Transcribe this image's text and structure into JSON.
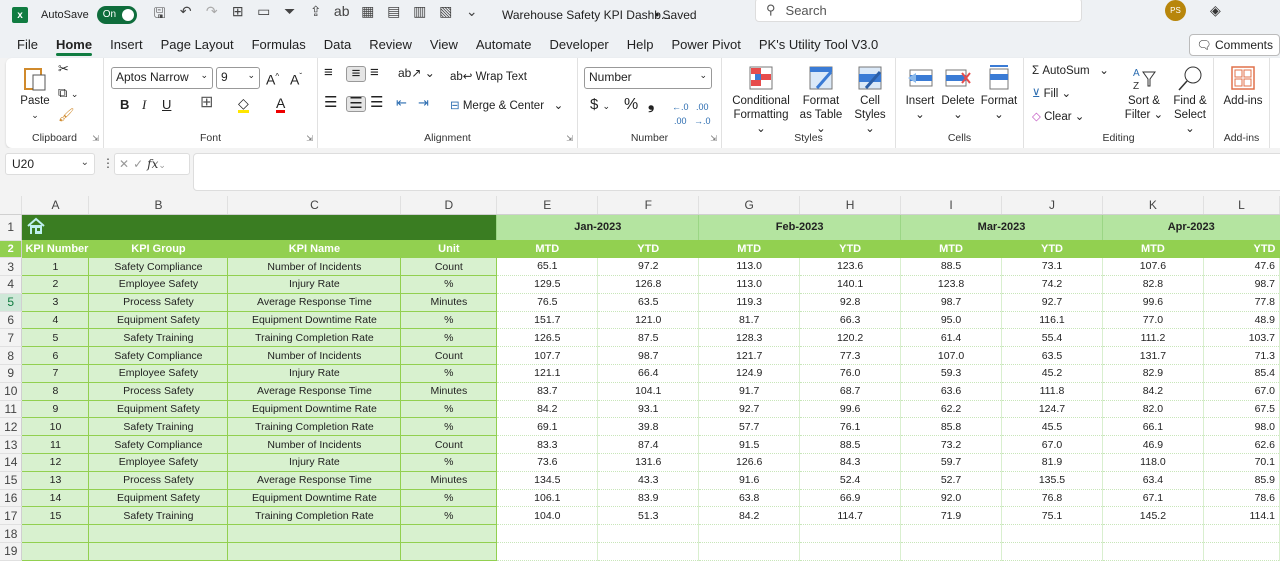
{
  "titlebar": {
    "autosave_label": "AutoSave",
    "autosave_state": "On",
    "doc_title": "Warehouse Safety KPI Dashb...",
    "saved_status": "• Saved",
    "search_placeholder": "Search",
    "user_initials": "PS"
  },
  "tabs": [
    "File",
    "Home",
    "Insert",
    "Page Layout",
    "Formulas",
    "Data",
    "Review",
    "View",
    "Automate",
    "Developer",
    "Help",
    "Power Pivot",
    "PK's Utility Tool V3.0"
  ],
  "active_tab": "Home",
  "comments_label": "Comments",
  "ribbon": {
    "clipboard": {
      "paste": "Paste",
      "label": "Clipboard"
    },
    "font": {
      "name": "Aptos Narrow",
      "size": "9",
      "label": "Font",
      "bold": "B",
      "italic": "I",
      "underline": "U"
    },
    "alignment": {
      "wrap_text": "Wrap Text",
      "merge_center": "Merge & Center",
      "label": "Alignment"
    },
    "number": {
      "format": "Number",
      "label": "Number",
      "currency": "$",
      "percent": "%",
      "comma": "❟",
      "inc_dec": ".00",
      "dec_dec": ".0"
    },
    "styles": {
      "conditional": "Conditional Formatting",
      "format_table": "Format as Table",
      "cell_styles": "Cell Styles",
      "label": "Styles"
    },
    "cells": {
      "insert": "Insert",
      "delete": "Delete",
      "format": "Format",
      "label": "Cells"
    },
    "editing": {
      "autosum": "AutoSum",
      "fill": "Fill",
      "clear": "Clear",
      "sort_filter": "Sort & Filter",
      "find_select": "Find & Select",
      "label": "Editing"
    },
    "addins": {
      "addins": "Add-ins",
      "label": "Add-ins"
    }
  },
  "formula_bar": {
    "name_box": "U20",
    "formula": ""
  },
  "sheet": {
    "columns": [
      "A",
      "B",
      "C",
      "D",
      "E",
      "F",
      "G",
      "H",
      "I",
      "J",
      "K",
      "L"
    ],
    "rows": [
      "1",
      "2",
      "3",
      "4",
      "5",
      "6",
      "7",
      "8",
      "9",
      "10",
      "11",
      "12",
      "13",
      "14",
      "15",
      "16",
      "17",
      "18",
      "19"
    ],
    "selected_row": "5",
    "months": [
      "Jan-2023",
      "Feb-2023",
      "Mar-2023",
      "Apr-2023"
    ],
    "headers": [
      "KPI Number",
      "KPI Group",
      "KPI Name",
      "Unit"
    ],
    "sub_headers": [
      "MTD",
      "YTD",
      "MTD",
      "YTD",
      "MTD",
      "YTD",
      "MTD",
      "YTD"
    ],
    "data": [
      [
        "1",
        "Safety Compliance",
        "Number of Incidents",
        "Count",
        "65.1",
        "97.2",
        "113.0",
        "123.6",
        "88.5",
        "73.1",
        "107.6",
        "47.6"
      ],
      [
        "2",
        "Employee Safety",
        "Injury Rate",
        "%",
        "129.5",
        "126.8",
        "113.0",
        "140.1",
        "123.8",
        "74.2",
        "82.8",
        "98.7"
      ],
      [
        "3",
        "Process Safety",
        "Average Response Time",
        "Minutes",
        "76.5",
        "63.5",
        "119.3",
        "92.8",
        "98.7",
        "92.7",
        "99.6",
        "77.8"
      ],
      [
        "4",
        "Equipment Safety",
        "Equipment Downtime Rate",
        "%",
        "151.7",
        "121.0",
        "81.7",
        "66.3",
        "95.0",
        "116.1",
        "77.0",
        "48.9"
      ],
      [
        "5",
        "Safety Training",
        "Training Completion Rate",
        "%",
        "126.5",
        "87.5",
        "128.3",
        "120.2",
        "61.4",
        "55.4",
        "111.2",
        "103.7"
      ],
      [
        "6",
        "Safety Compliance",
        "Number of Incidents",
        "Count",
        "107.7",
        "98.7",
        "121.7",
        "77.3",
        "107.0",
        "63.5",
        "131.7",
        "71.3"
      ],
      [
        "7",
        "Employee Safety",
        "Injury Rate",
        "%",
        "121.1",
        "66.4",
        "124.9",
        "76.0",
        "59.3",
        "45.2",
        "82.9",
        "85.4"
      ],
      [
        "8",
        "Process Safety",
        "Average Response Time",
        "Minutes",
        "83.7",
        "104.1",
        "91.7",
        "68.7",
        "63.6",
        "111.8",
        "84.2",
        "67.0"
      ],
      [
        "9",
        "Equipment Safety",
        "Equipment Downtime Rate",
        "%",
        "84.2",
        "93.1",
        "92.7",
        "99.6",
        "62.2",
        "124.7",
        "82.0",
        "67.5"
      ],
      [
        "10",
        "Safety Training",
        "Training Completion Rate",
        "%",
        "69.1",
        "39.8",
        "57.7",
        "76.1",
        "85.8",
        "45.5",
        "66.1",
        "98.0"
      ],
      [
        "11",
        "Safety Compliance",
        "Number of Incidents",
        "Count",
        "83.3",
        "87.4",
        "91.5",
        "88.5",
        "73.2",
        "67.0",
        "46.9",
        "62.6"
      ],
      [
        "12",
        "Employee Safety",
        "Injury Rate",
        "%",
        "73.6",
        "131.6",
        "126.6",
        "84.3",
        "59.7",
        "81.9",
        "118.0",
        "70.1"
      ],
      [
        "13",
        "Process Safety",
        "Average Response Time",
        "Minutes",
        "134.5",
        "43.3",
        "91.6",
        "52.4",
        "52.7",
        "135.5",
        "63.4",
        "85.9"
      ],
      [
        "14",
        "Equipment Safety",
        "Equipment Downtime Rate",
        "%",
        "106.1",
        "83.9",
        "63.8",
        "66.9",
        "92.0",
        "76.8",
        "67.1",
        "78.6"
      ],
      [
        "15",
        "Safety Training",
        "Training Completion Rate",
        "%",
        "104.0",
        "51.3",
        "84.2",
        "114.7",
        "71.9",
        "75.1",
        "145.2",
        "114.1"
      ],
      [
        "",
        "",
        "",
        "",
        "",
        "",
        "",
        "",
        "",
        "",
        "",
        ""
      ],
      [
        "",
        "",
        "",
        "",
        "",
        "",
        "",
        "",
        "",
        "",
        "",
        ""
      ]
    ]
  }
}
